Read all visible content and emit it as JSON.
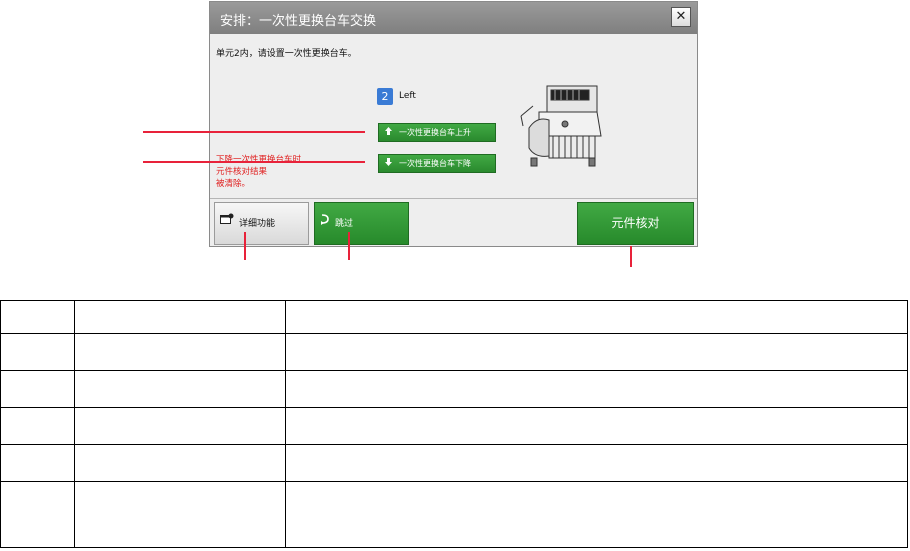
{
  "dialog": {
    "title": "安排：一次性更换台车交换",
    "close_label": "✕",
    "instruction": "单元2内，请设置一次性更换台车。",
    "unit_number": "2",
    "unit_side": "Left",
    "cart_up_label": "一次性更换台车上升",
    "cart_down_label": "一次性更换台车下降",
    "warning": "下降一次性更换台车时\n元件核对结果\n被清除。",
    "buttons": {
      "detail": "详细功能",
      "skip": "跳过",
      "verify": "元件核对"
    }
  },
  "icons": {
    "arrow_up": "arrow-up-icon",
    "arrow_down": "arrow-down-icon",
    "detail": "settings-window-icon",
    "skip": "skip-icon"
  },
  "colors": {
    "accent_green": "#2e9632",
    "unit_blue": "#3a7bd5",
    "warning_red": "#e02020",
    "callout_red": "#e8223a"
  },
  "legend_table": {
    "rows": [
      [
        "",
        "",
        ""
      ],
      [
        "",
        "",
        ""
      ],
      [
        "",
        "",
        ""
      ],
      [
        "",
        "",
        ""
      ],
      [
        "",
        "",
        ""
      ],
      [
        "",
        "",
        ""
      ]
    ]
  }
}
